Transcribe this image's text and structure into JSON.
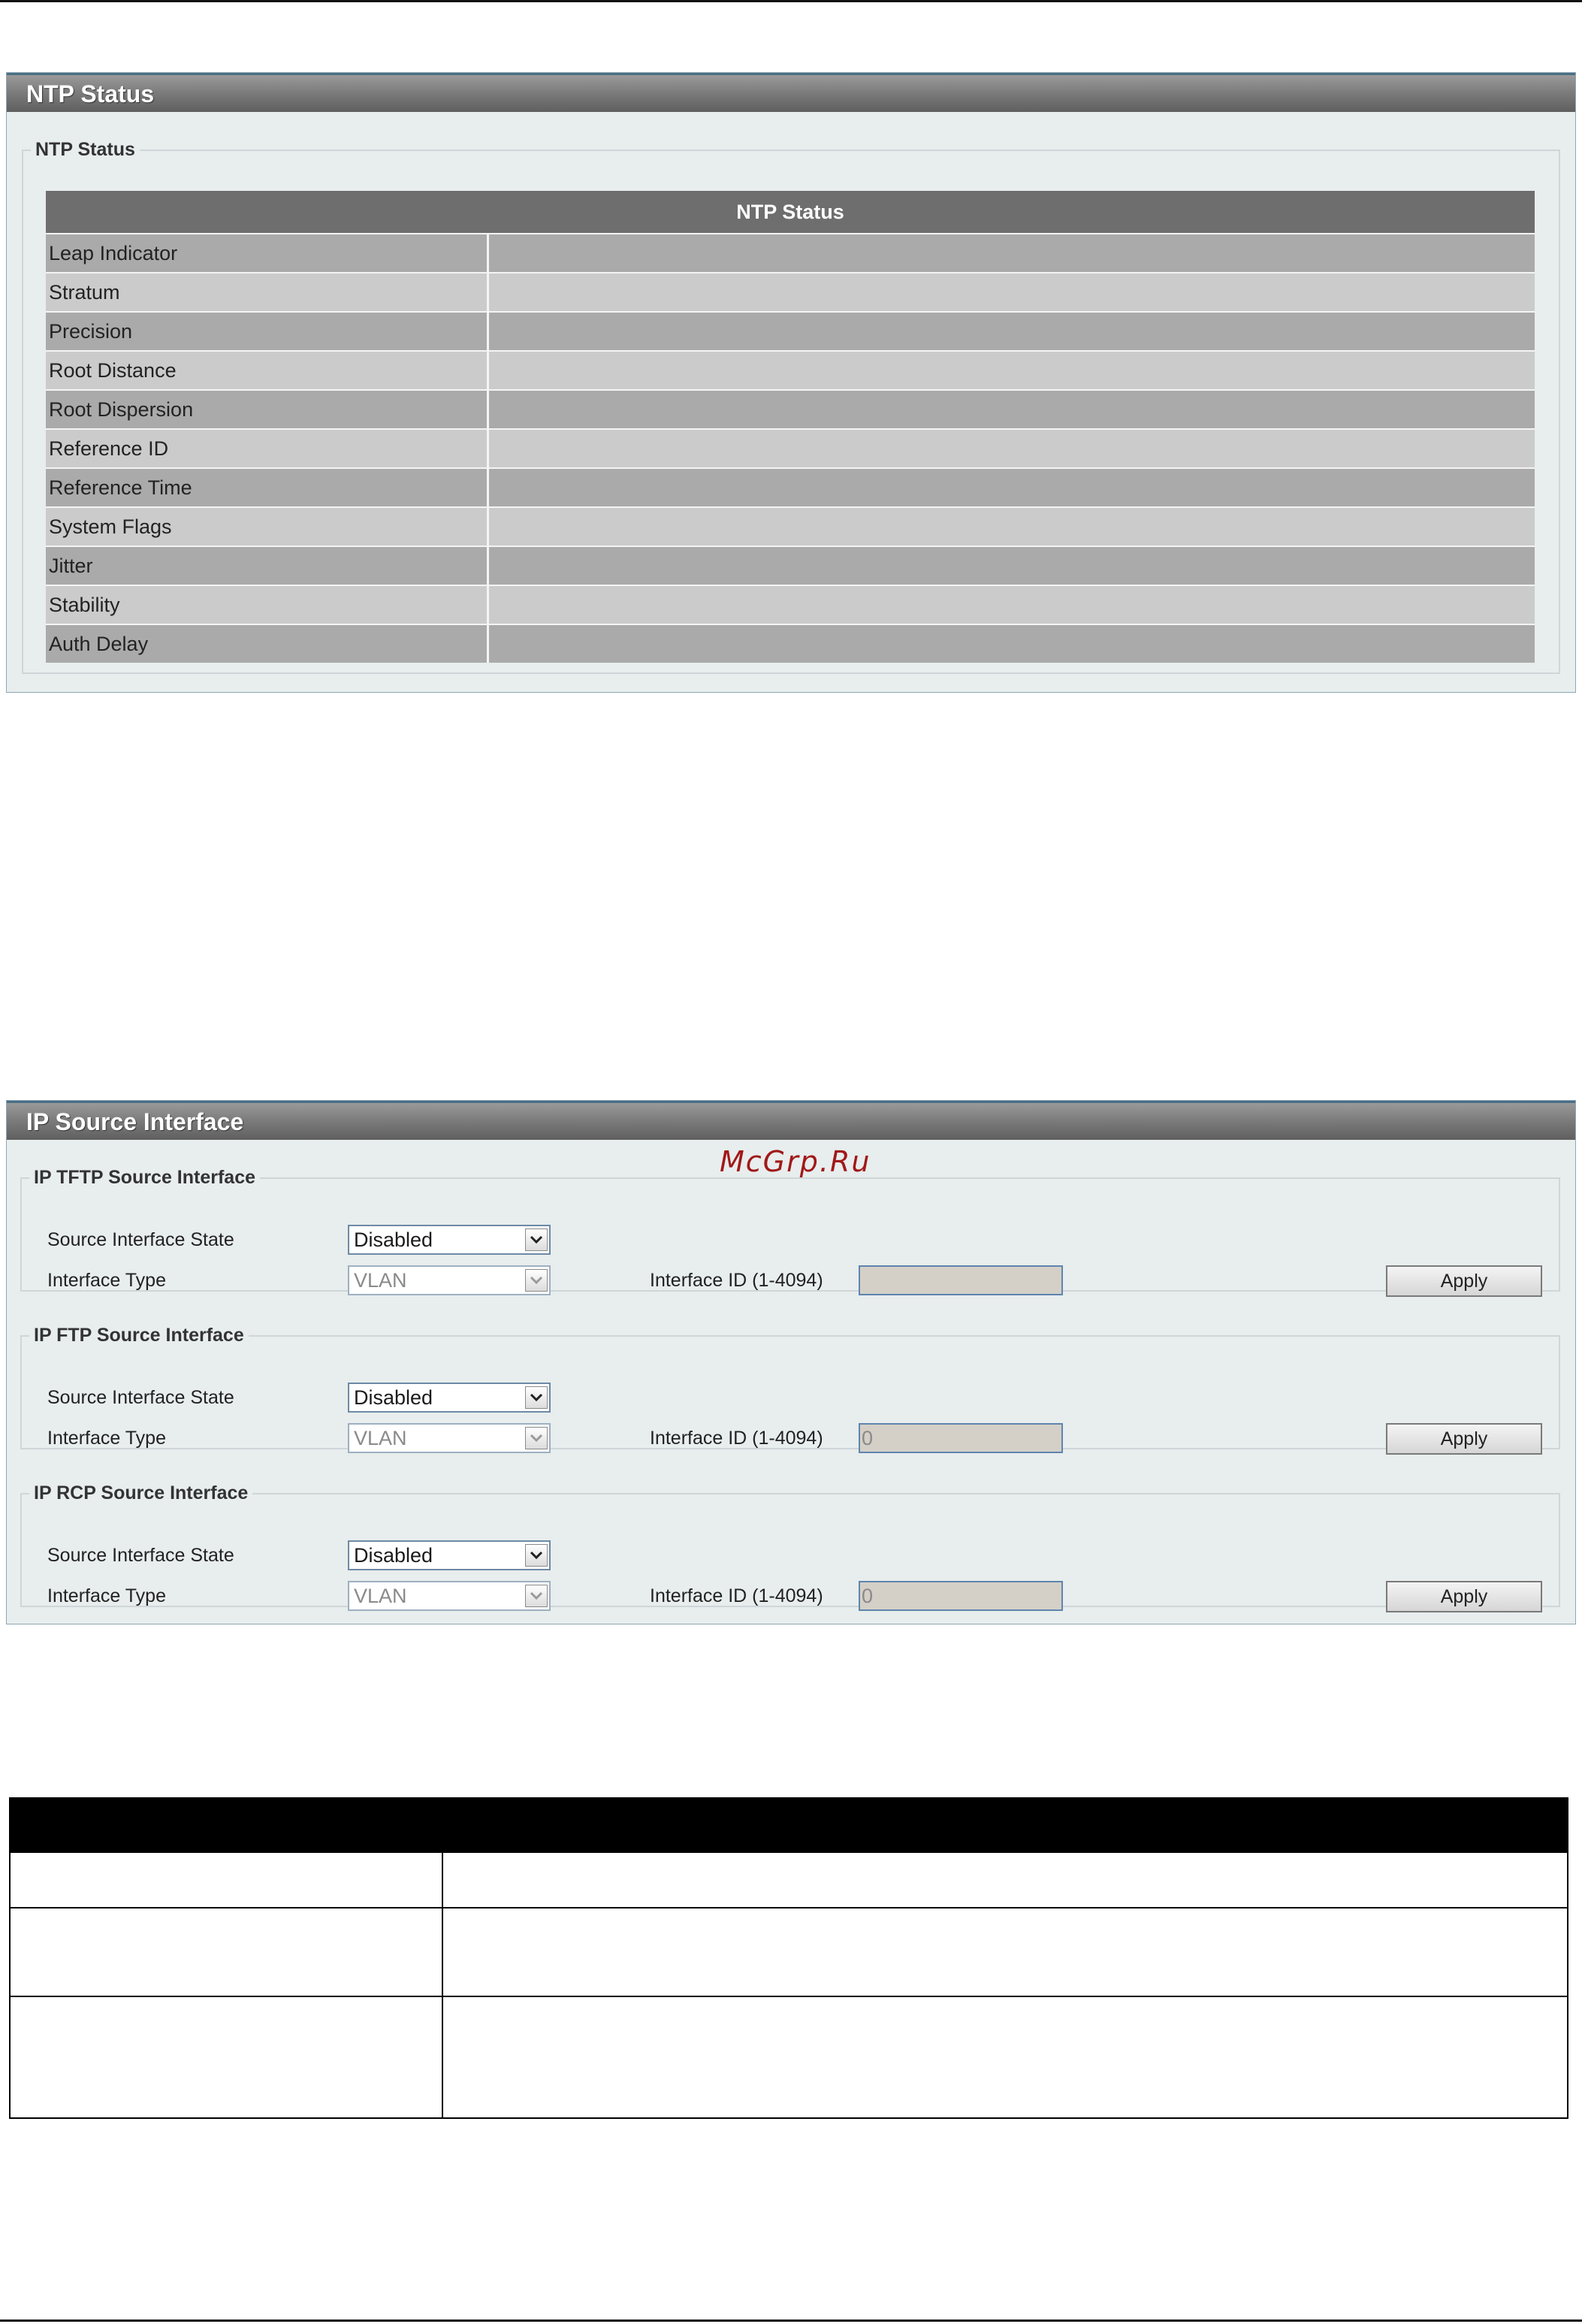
{
  "ntp": {
    "panel_title": "NTP Status",
    "legend": "NTP Status",
    "table_header": "NTP Status",
    "rows": [
      {
        "label": "Leap Indicator",
        "value": ""
      },
      {
        "label": "Stratum",
        "value": ""
      },
      {
        "label": "Precision",
        "value": ""
      },
      {
        "label": "Root Distance",
        "value": ""
      },
      {
        "label": "Root Dispersion",
        "value": ""
      },
      {
        "label": "Reference ID",
        "value": ""
      },
      {
        "label": "Reference Time",
        "value": ""
      },
      {
        "label": "System Flags",
        "value": ""
      },
      {
        "label": "Jitter",
        "value": ""
      },
      {
        "label": "Stability",
        "value": ""
      },
      {
        "label": "Auth Delay",
        "value": ""
      }
    ]
  },
  "ip_source": {
    "panel_title": "IP Source Interface",
    "watermark": "McGrp.Ru",
    "sections": [
      {
        "legend": "IP TFTP Source Interface",
        "state_label": "Source Interface State",
        "state_value": "Disabled",
        "type_label": "Interface Type",
        "type_value": "VLAN",
        "id_label": "Interface ID (1-4094)",
        "id_value": "",
        "apply_label": "Apply"
      },
      {
        "legend": "IP FTP Source Interface",
        "state_label": "Source Interface State",
        "state_value": "Disabled",
        "type_label": "Interface Type",
        "type_value": "VLAN",
        "id_label": "Interface ID (1-4094)",
        "id_value": "0",
        "apply_label": "Apply"
      },
      {
        "legend": "IP RCP Source Interface",
        "state_label": "Source Interface State",
        "state_value": "Disabled",
        "type_label": "Interface Type",
        "type_value": "VLAN",
        "id_label": "Interface ID (1-4094)",
        "id_value": "0",
        "apply_label": "Apply"
      }
    ]
  },
  "colors": {
    "panel_bg": "#e8eded",
    "table_dark_row": "#aaaaaa",
    "table_light_row": "#cbcbcb",
    "header_grey": "#6e6e6e"
  },
  "icons": {
    "dropdown": "chevron-down-icon"
  }
}
